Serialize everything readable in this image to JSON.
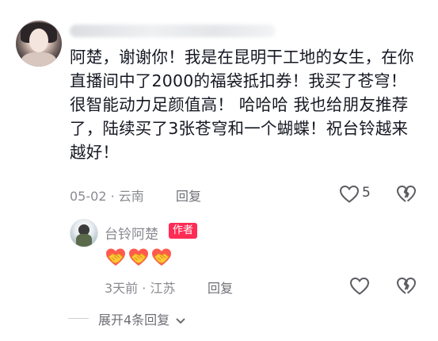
{
  "comment": {
    "author_name": "",
    "text": "阿楚，谢谢你！我是在昆明干工地的女生，在你直播间中了2000的福袋抵扣券！我买了苍穹！很智能动力足颜值高！ 哈哈哈 我也给朋友推荐了，陆续买了3张苍穹和一个蝴蝶！祝台铃越来越好！",
    "date": "05-02",
    "separator": "·",
    "location": "云南",
    "reply_label": "回复",
    "like_count": "5"
  },
  "reply": {
    "author_name": "台铃阿楚",
    "badge": "作者",
    "emoji": "🤝🤝🤝",
    "time": "3天前",
    "separator": "·",
    "location": "江苏",
    "reply_label": "回复"
  },
  "expand_label": "展开4条回复",
  "icons": {
    "like": "heart-outline-icon",
    "dislike": "broken-heart-icon",
    "expand": "chevron-down-icon"
  },
  "colors": {
    "badge_bg": "#fe2c55",
    "meta_text": "#8a8b91",
    "body_text": "#161823"
  }
}
